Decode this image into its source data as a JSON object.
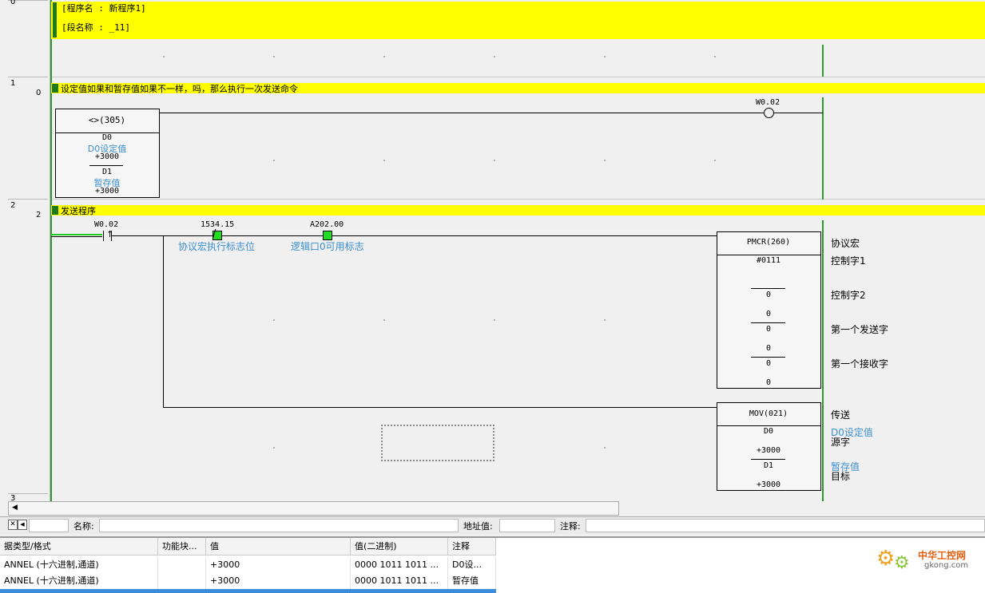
{
  "section": {
    "program_name": "[程序名 : 新程序1]",
    "section_name": "[段名称 : _11]"
  },
  "gutter": {
    "rows": [
      {
        "rung": "0",
        "step": ""
      },
      {
        "rung": "1",
        "step": "0"
      },
      {
        "rung": "2",
        "step": "2"
      },
      {
        "rung": "3",
        "step": ""
      }
    ]
  },
  "rung1": {
    "comment": "设定值如果和暂存值如果不一样，吗，那么执行一次发送命令",
    "compare": {
      "name": "<>(305)",
      "op1": "D0",
      "op1_comment": "D0设定值",
      "op1_value": "+3000",
      "op2": "D1",
      "op2_comment": "暂存值",
      "op2_value": "+3000"
    },
    "coil": "W0.02"
  },
  "rung2": {
    "comment": "发送程序",
    "contact1": "W0.02",
    "contact2": "1534.15",
    "contact2_comment": "协议宏执行标志位",
    "contact3": "A202.00",
    "contact3_comment": "逻辑口0可用标志",
    "pmcr": {
      "name": "PMCR(260)",
      "op1": "#0111",
      "op2": "0",
      "op3a": "0",
      "op3b": "0",
      "op4a": "0",
      "op4b": "0",
      "op5": "0",
      "label_title": "协议宏",
      "label1": "控制字1",
      "label2": "控制字2",
      "label3": "第一个发送字",
      "label4": "第一个接收字"
    },
    "mov": {
      "name": "MOV(021)",
      "src": "D0",
      "src_value": "+3000",
      "dst": "D1",
      "dst_value": "+3000",
      "label_title": "传送",
      "src_comment": "D0设定值",
      "src_label": "源字",
      "dst_comment": "暂存值",
      "dst_label": "目标"
    }
  },
  "namebar": {
    "name_label": "名称:",
    "address_label": "地址值:",
    "comment_label": "注释:"
  },
  "watch": {
    "headers": [
      "据类型/格式",
      "功能块...",
      "值",
      "值(二进制)",
      "注释"
    ],
    "rows": [
      [
        "ANNEL (十六进制,通道)",
        "",
        "+3000",
        "0000 1011 1011 ...",
        "D0设..."
      ],
      [
        "ANNEL (十六进制,通道)",
        "",
        "+3000",
        "0000 1011 1011 ...",
        "暂存值"
      ]
    ]
  },
  "watermark": {
    "brand": "中华工控网",
    "domain": "gkong.com"
  },
  "colors": {
    "comment_bar": "#ffff00",
    "power_rail": "#2e9a2e",
    "active_contact": "#22dd22",
    "comment_text": "#3b8fd0",
    "selected_row": "#3c8ddc"
  }
}
